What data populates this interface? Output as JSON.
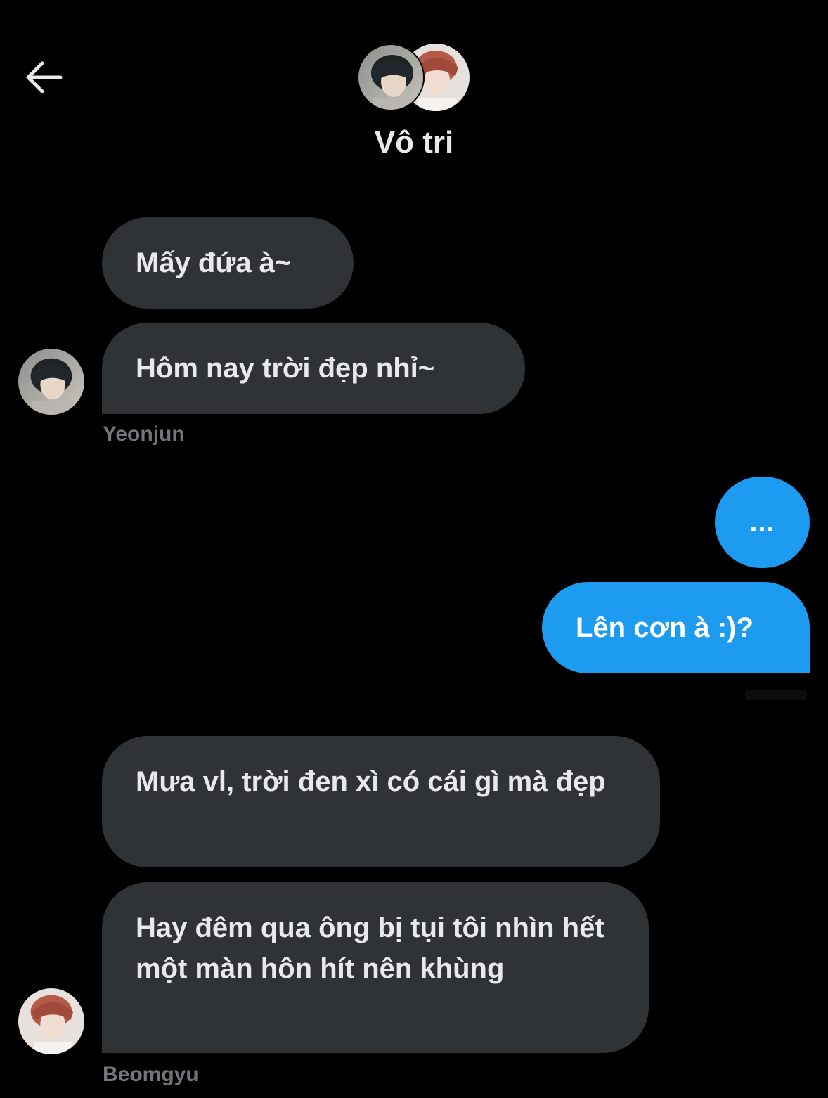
{
  "header": {
    "title": "Vô tri",
    "back_icon": "arrow-left-icon"
  },
  "messages": [
    {
      "direction": "incoming",
      "text": "Mấy đứa à~"
    },
    {
      "direction": "incoming",
      "text": "Hôm nay trời đẹp nhỉ~",
      "sender": "Yeonjun"
    },
    {
      "direction": "outgoing",
      "text": "..."
    },
    {
      "direction": "outgoing",
      "text": "Lên cơn à :)?"
    },
    {
      "direction": "incoming",
      "text": "Mưa vl, trời đen xì có cái gì mà đẹp"
    },
    {
      "direction": "incoming",
      "text": "Hay đêm qua ông bị tụi tôi nhìn hết một màn hôn hít nên khùng",
      "sender": "Beomgyu"
    }
  ],
  "colors": {
    "background": "#000000",
    "incoming_bubble": "#2f3336",
    "outgoing_bubble": "#1d9bf0",
    "sender_name": "#71767b"
  }
}
